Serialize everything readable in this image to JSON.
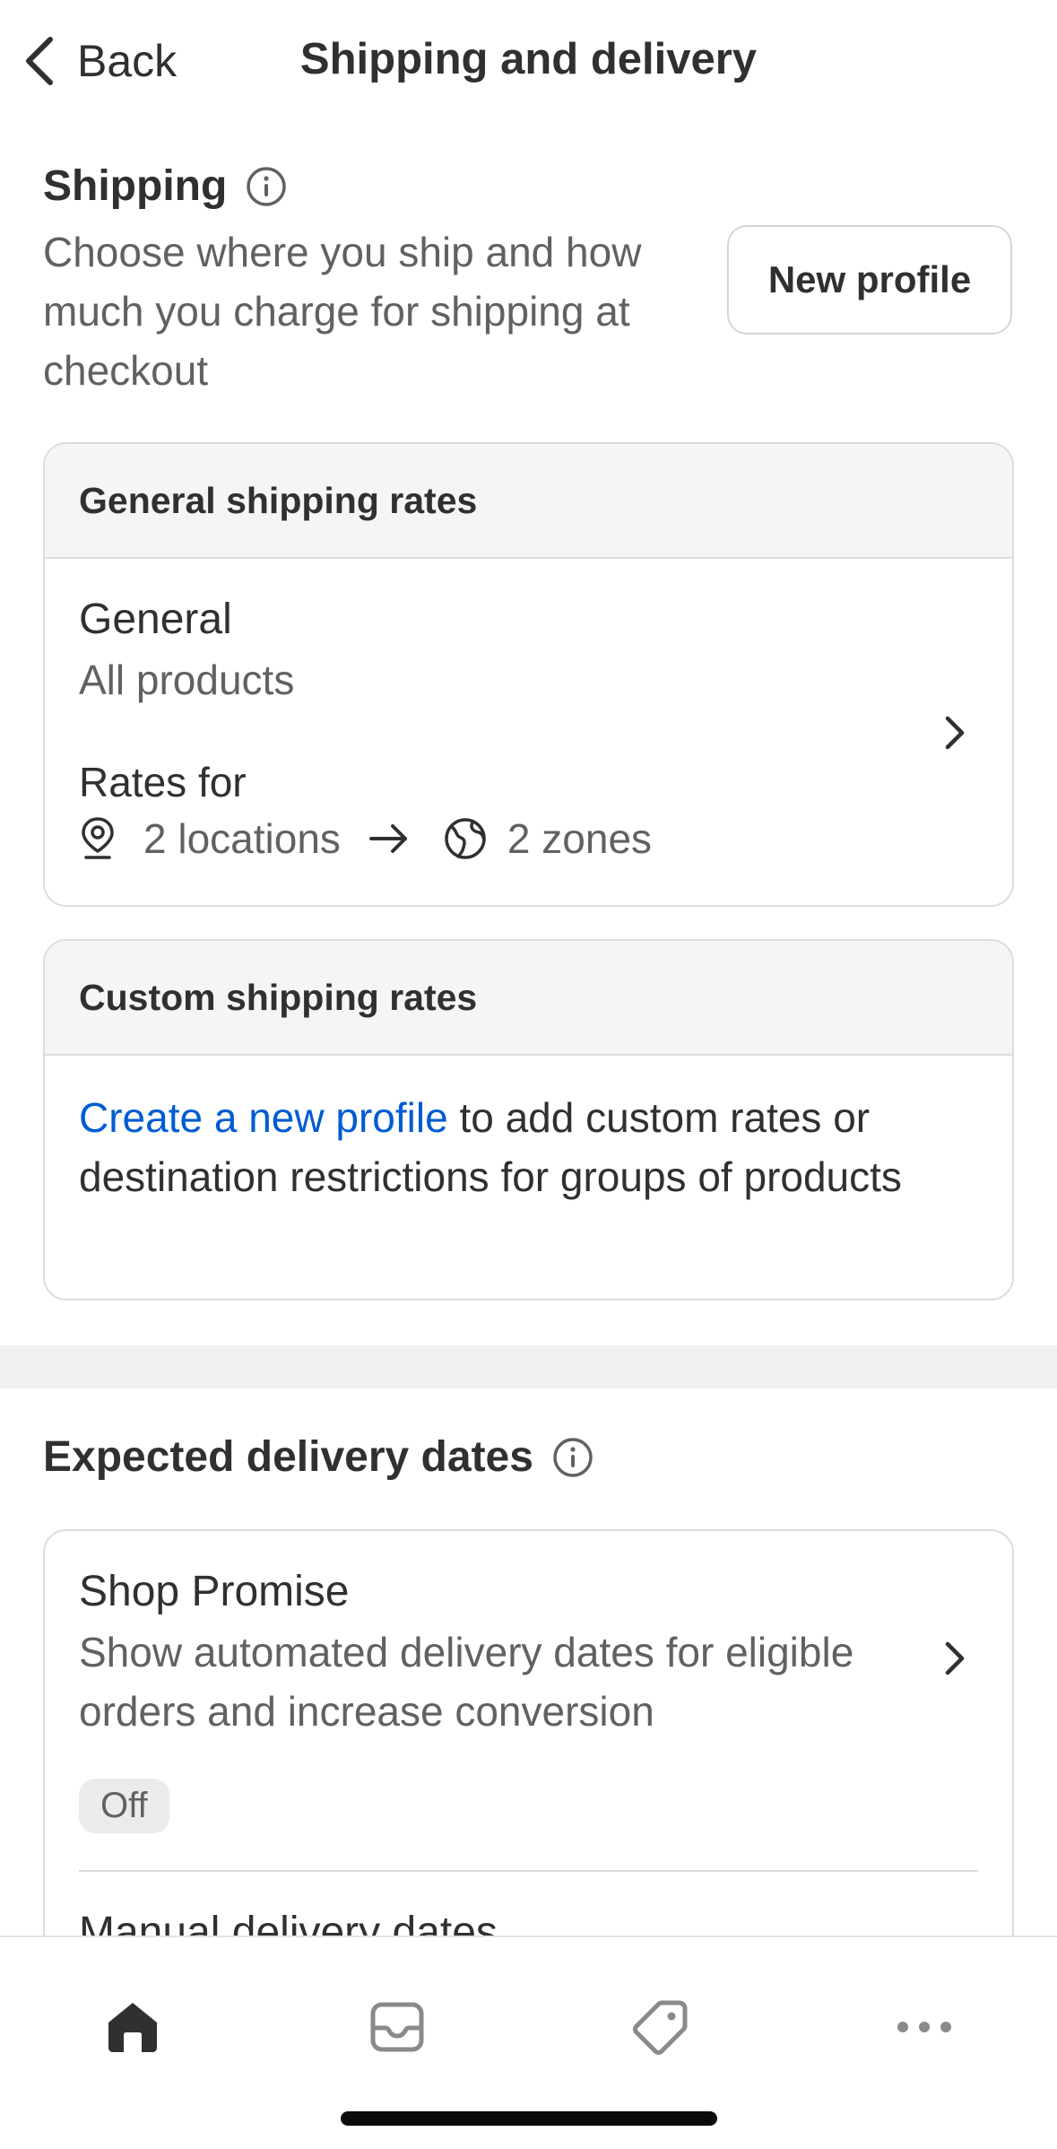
{
  "header": {
    "back_label": "Back",
    "title": "Shipping and delivery"
  },
  "shipping": {
    "heading": "Shipping",
    "description": "Choose where you ship and how much you charge for shipping at checkout",
    "new_profile_label": "New profile"
  },
  "general_card": {
    "header": "General shipping rates",
    "profile_name": "General",
    "profile_scope": "All products",
    "rates_for_label": "Rates for",
    "locations_text": "2 locations",
    "zones_text": "2 zones"
  },
  "custom_card": {
    "header": "Custom shipping rates",
    "link_text": "Create a new profile",
    "body_text": " to add custom rates or destination restrictions for groups of products"
  },
  "delivery": {
    "heading": "Expected delivery dates",
    "shop_promise_title": "Shop Promise",
    "shop_promise_desc": "Show automated delivery dates for eligible orders and increase conversion",
    "shop_promise_status": "Off",
    "manual_title": "Manual delivery dates"
  },
  "nav": {
    "items": [
      "home-icon",
      "inbox-icon",
      "tag-icon",
      "more-icon"
    ],
    "active_color": "#303030",
    "inactive_color": "#8a8a8a"
  },
  "colors": {
    "link": "#005bd3",
    "text_primary": "#303030",
    "text_secondary": "#616161"
  }
}
